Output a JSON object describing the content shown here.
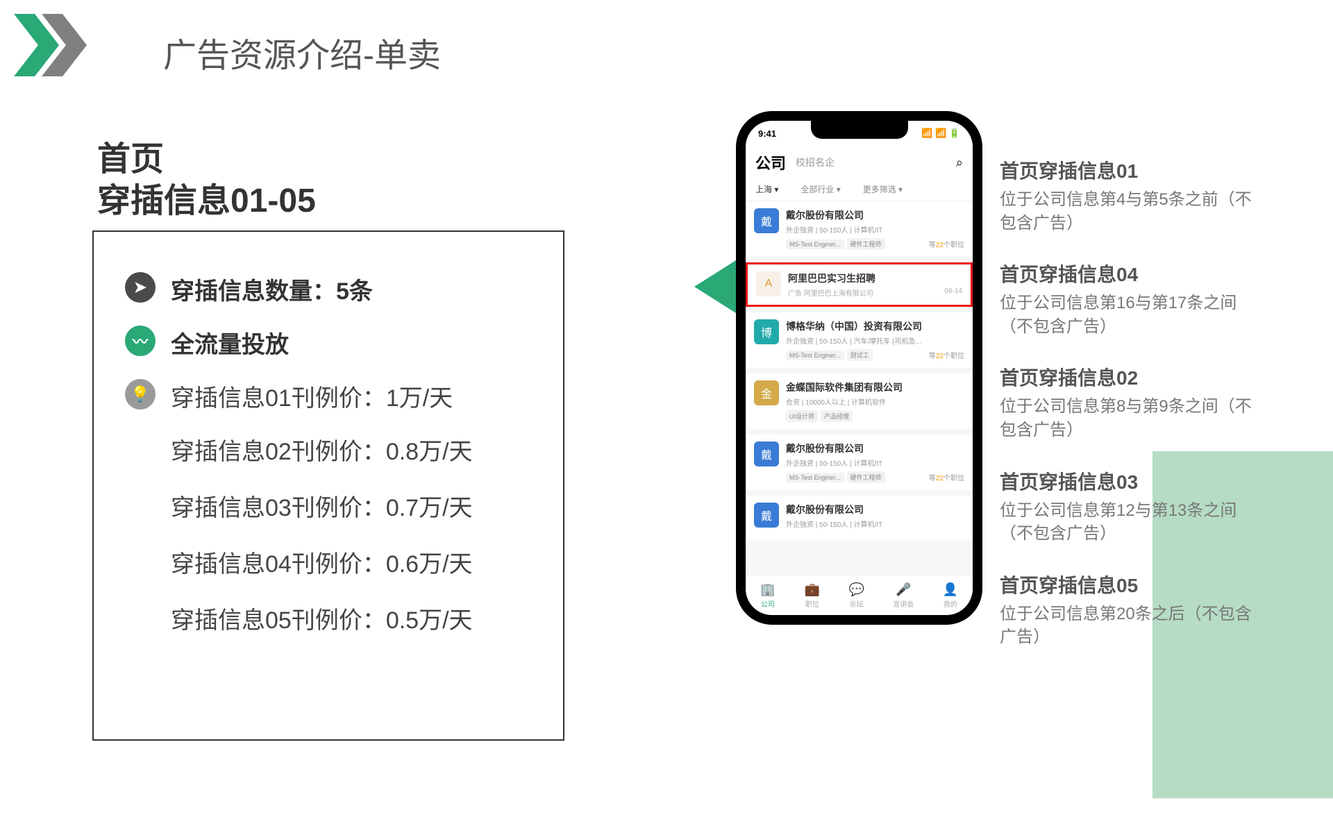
{
  "slide_title": "广告资源介绍-单卖",
  "section": {
    "line1": "首页",
    "line2": "穿插信息01-05"
  },
  "bullets": {
    "count": "穿插信息数量：5条",
    "traffic": "全流量投放"
  },
  "prices": [
    "穿插信息01刊例价：1万/天",
    "穿插信息02刊例价：0.8万/天",
    "穿插信息03刊例价：0.7万/天",
    "穿插信息04刊例价：0.6万/天",
    "穿插信息05刊例价：0.5万/天"
  ],
  "phone": {
    "time": "9:41",
    "header": {
      "primary": "公司",
      "secondary": "校招名企",
      "search_icon": "⌕"
    },
    "filters": {
      "city": "上海 ▾",
      "industry": "全部行业 ▾",
      "more": "更多筛选 ▾"
    },
    "cards": [
      {
        "logo": "戴",
        "cls": "c-blue",
        "title": "戴尔股份有限公司",
        "meta": "外企独资 | 50-150人 | 计算机/IT",
        "tags": [
          "MS-Test Enginer...",
          "硬件工程师"
        ],
        "count_pre": "等",
        "count_num": "22",
        "count_suf": "个职位"
      },
      {
        "logo": "A",
        "cls": "c-orange",
        "title": "阿里巴巴实习生招聘",
        "ad_label": "广告",
        "ad_meta": "阿里巴巴上海有限公司",
        "date": "06-14",
        "highlight": true
      },
      {
        "logo": "博",
        "cls": "c-teal",
        "title": "博格华纳（中国）投资有限公司",
        "meta": "外企独资 | 50-150人 | 汽车/摩托车 (司机急...",
        "tags": [
          "MS-Test Enginer...",
          "测试工"
        ],
        "count_pre": "等",
        "count_num": "22",
        "count_suf": "个职位"
      },
      {
        "logo": "金",
        "cls": "c-gold",
        "title": "金蝶国际软件集团有限公司",
        "meta": "合资 | 10000人以上 | 计算机软件",
        "tags": [
          "UI设计师",
          "产品经理"
        ]
      },
      {
        "logo": "戴",
        "cls": "c-blue",
        "title": "戴尔股份有限公司",
        "meta": "外企独资 | 50-150人 | 计算机/IT",
        "tags": [
          "MS-Test Enginer...",
          "硬件工程师"
        ],
        "count_pre": "等",
        "count_num": "22",
        "count_suf": "个职位"
      },
      {
        "logo": "戴",
        "cls": "c-blue",
        "title": "戴尔股份有限公司",
        "meta": "外企独资 | 50-150人 | 计算机/IT"
      }
    ],
    "nav": [
      {
        "icon": "🏢",
        "label": "公司",
        "active": true
      },
      {
        "icon": "💼",
        "label": "职位"
      },
      {
        "icon": "💬",
        "label": "论坛"
      },
      {
        "icon": "🎤",
        "label": "宣讲会"
      },
      {
        "icon": "👤",
        "label": "我的"
      }
    ]
  },
  "annotations": [
    {
      "title": "首页穿插信息01",
      "body": "位于公司信息第4与第5条之前（不包含广告）"
    },
    {
      "title": "首页穿插信息04",
      "body": "位于公司信息第16与第17条之间（不包含广告）"
    },
    {
      "title": "首页穿插信息02",
      "body": "位于公司信息第8与第9条之间（不包含广告）"
    },
    {
      "title": "首页穿插信息03",
      "body": "位于公司信息第12与第13条之间（不包含广告）"
    },
    {
      "title": "首页穿插信息05",
      "body": "位于公司信息第20条之后（不包含广告）"
    }
  ]
}
